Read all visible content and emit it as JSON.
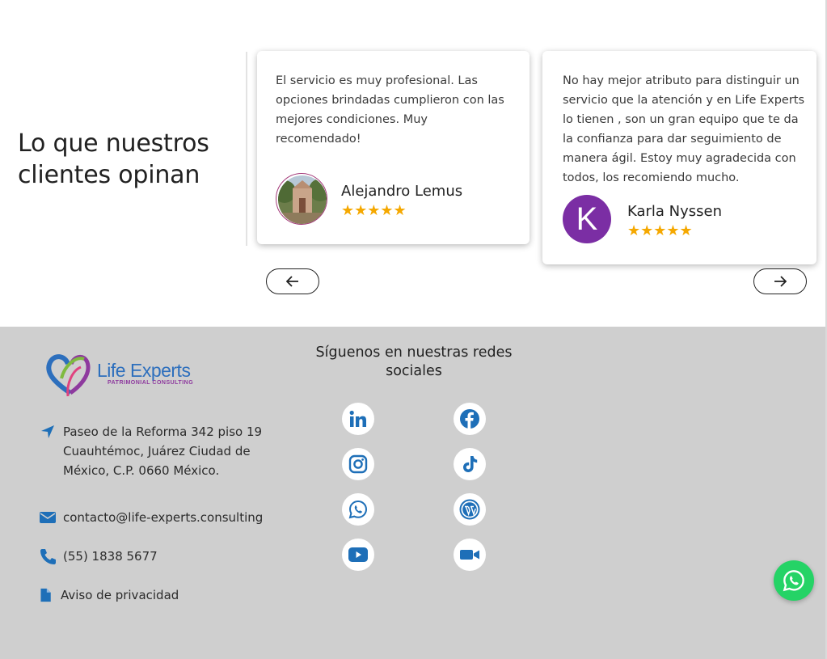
{
  "testimonials": {
    "title": "Lo que nuestros clientes opinan",
    "items": [
      {
        "quote": "El servicio es muy profesional. Las opciones brindadas cumplieron con las mejores condiciones. Muy recomendado!",
        "author": "Alejandro Lemus",
        "stars": "★★★★★",
        "rating": 5
      },
      {
        "quote": "No hay mejor atributo para distinguir un servicio que la atención y en Life Experts lo tienen , son un gran equipo que te da la confianza para dar seguimiento de manera ágil. Estoy muy agradecida con todos, los recomiendo mucho.",
        "author": "Karla Nyssen",
        "avatar_letter": "K",
        "stars": "★★★★★",
        "rating": 5
      }
    ]
  },
  "footer": {
    "logo": {
      "name": "Life Experts",
      "tagline": "PATRIMONIAL CONSULTING"
    },
    "address": "Paseo de la Reforma 342 piso 19 Cuauhtémoc, Juárez Ciudad de México, C.P. 0660 México.",
    "email": "contacto@life-experts.consulting",
    "phone": "(55) 1838 5677",
    "privacy": "Aviso de privacidad",
    "social_title": "Síguenos en nuestras redes sociales",
    "social": [
      "linkedin-icon",
      "facebook-icon",
      "instagram-icon",
      "tiktok-icon",
      "whatsapp-icon",
      "wordpress-icon",
      "youtube-icon",
      "video-icon"
    ]
  },
  "colors": {
    "accent_blue": "#1e6fb8",
    "star": "#f5a800",
    "footer_bg": "#cfcfcf",
    "whatsapp": "#25d366",
    "avatar_purple": "#7b2ea4"
  }
}
